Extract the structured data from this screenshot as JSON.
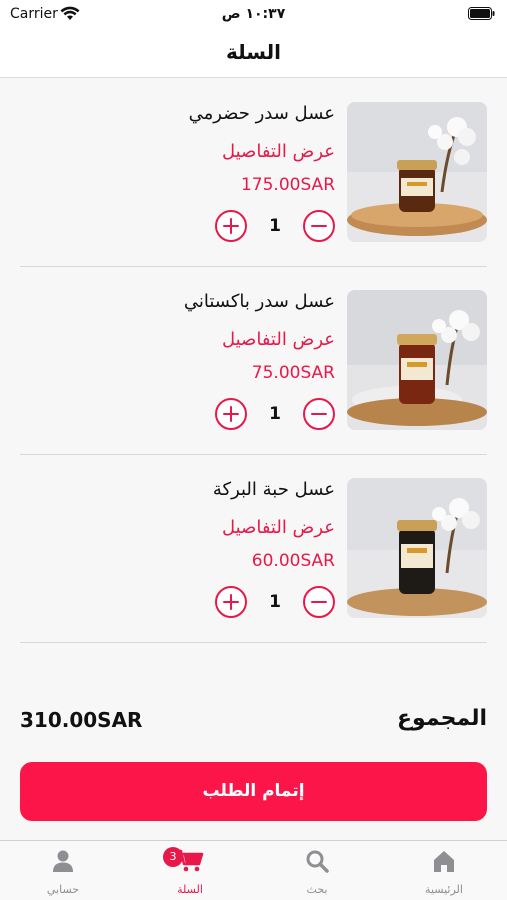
{
  "status_bar": {
    "carrier": "Carrier",
    "time": "١٠:٣٧ ص"
  },
  "nav": {
    "title": "السلة"
  },
  "cart": {
    "items": [
      {
        "name": "عسل سدر حضرمي",
        "details_label": "عرض التفاصيل",
        "price": "175.00SAR",
        "quantity": "1",
        "honey_color": "#5a2a10"
      },
      {
        "name": "عسل سدر باكستاني",
        "details_label": "عرض التفاصيل",
        "price": "75.00SAR",
        "quantity": "1",
        "honey_color": "#7a2712"
      },
      {
        "name": "عسل حبة البركة",
        "details_label": "عرض التفاصيل",
        "price": "60.00SAR",
        "quantity": "1",
        "honey_color": "#1e1a16"
      }
    ]
  },
  "summary": {
    "total_label": "المجموع",
    "total_value": "310.00SAR"
  },
  "checkout": {
    "label": "إتمام الطلب"
  },
  "tabs": [
    {
      "label": "الرئيسية",
      "icon": "home-icon"
    },
    {
      "label": "بحث",
      "icon": "search-icon"
    },
    {
      "label": "السلة",
      "icon": "cart-icon",
      "badge": "3",
      "active": true
    },
    {
      "label": "حسابي",
      "icon": "person-icon"
    }
  ],
  "colors": {
    "accent": "#e8194a",
    "button": "#fb1548"
  }
}
